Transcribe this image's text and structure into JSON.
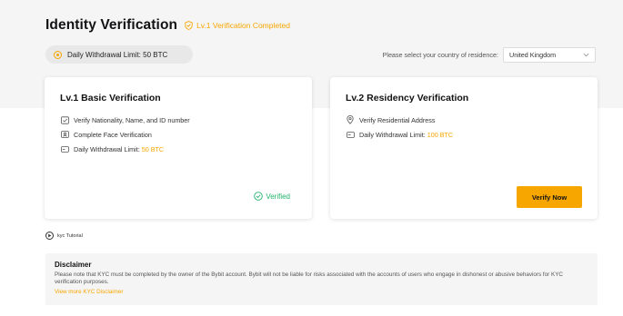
{
  "header": {
    "title": "Identity Verification",
    "status": "Lv.1 Verification Completed"
  },
  "limit": {
    "label": "Daily Withdrawal Limit:",
    "value": "50 BTC"
  },
  "country": {
    "prompt": "Please select your country of residence:",
    "selected": "United Kingdom"
  },
  "cards": [
    {
      "title": "Lv.1 Basic Verification",
      "features": [
        "Verify Nationality, Name, and ID number",
        "Complete Face Verification"
      ],
      "limit_label": "Daily Withdrawal Limit:",
      "limit_value": "50 BTC",
      "status": "Verified"
    },
    {
      "title": "Lv.2 Residency Verification",
      "features": [
        "Verify Residential Address"
      ],
      "limit_label": "Daily Withdrawal Limit:",
      "limit_value": "100 BTC",
      "button": "Verify Now"
    }
  ],
  "tutorial": "kyc Tutorial",
  "disclaimer": {
    "title": "Disclaimer",
    "text": "Please note that KYC must be completed by the owner of the Bybit account. Bybit will not be liable for risks associated with the accounts of users who engage in dishonest or abusive behaviors for KYC verification purposes.",
    "link": "View more KYC Disclaimer"
  },
  "colors": {
    "accent": "#f7a600",
    "success": "#20b26c",
    "band": "#f5f5f5"
  },
  "icons": [
    "shield-check-icon",
    "coin-icon",
    "chevron-down-icon",
    "id-check-icon",
    "face-icon",
    "card-icon",
    "check-circle-icon",
    "location-icon",
    "play-icon"
  ]
}
